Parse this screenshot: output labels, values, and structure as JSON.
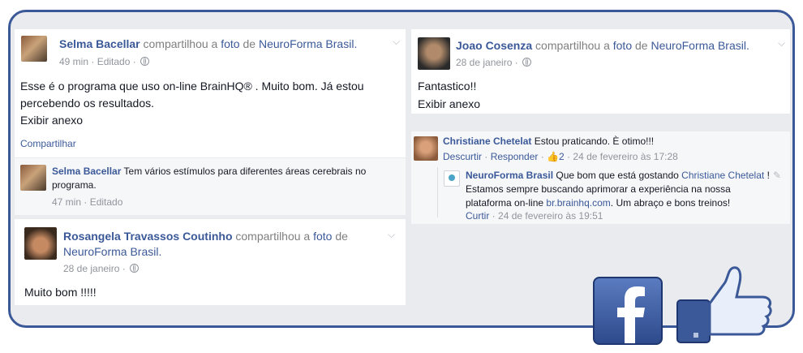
{
  "post1": {
    "author": "Selma Bacellar",
    "action_shared": "compartilhou a",
    "action_photo": "foto",
    "action_of": "de",
    "page": "NeuroForma Brasil",
    "time": "49 min",
    "edited": "Editado",
    "text_line1": "Esse é o programa que uso on-line BrainHQ® . Muito bom. Já estou",
    "text_line2": "percebendo os resultados.",
    "attachment": "Exibir anexo",
    "share": "Compartilhar",
    "comment": {
      "author": "Selma Bacellar",
      "text_line1": "Tem vários estímulos para diferentes áreas cerebrais no",
      "text_line2": "programa.",
      "time": "47 min",
      "edited": "Editado"
    }
  },
  "post2": {
    "author": "Rosangela Travassos Coutinho",
    "action_shared": "compartilhou a",
    "action_photo": "foto",
    "action_of": "de",
    "page": "NeuroForma Brasil.",
    "date": "28 de janeiro",
    "text": "Muito bom !!!!!"
  },
  "post3": {
    "author": "Joao Cosenza",
    "action_shared": "compartilhou a",
    "action_photo": "foto",
    "action_of": "de",
    "page": "NeuroForma Brasil",
    "date": "28 de janeiro",
    "text": "Fantastico!!",
    "attachment": "Exibir anexo"
  },
  "comment_thread": {
    "author": "Christiane Chetelat",
    "text": "Estou praticando. È otimo!!!",
    "unlike": "Descurtir",
    "reply": "Responder",
    "likes": "2",
    "time": "24 de fevereiro às 17:28",
    "reply_comment": {
      "author": "NeuroForma Brasil",
      "text1": "Que bom que está gostando",
      "mention": "Christiane Chetelat",
      "text1_end": "!",
      "text2": "Estamos sempre buscando aprimorar a experiência na nossa",
      "text3_start": "plataforma on-line",
      "url": "br.brainhq.com",
      "text3_end": ". Um abraço e bons treinos!",
      "like": "Curtir",
      "time": "24 de fevereiro às 19:51"
    }
  },
  "colors": {
    "brand": "#3b5998",
    "frame": "#3b5998",
    "background": "#e9ebee"
  }
}
